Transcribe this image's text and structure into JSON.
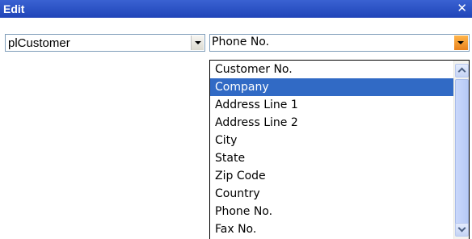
{
  "window": {
    "title": "Edit",
    "close_glyph": "✕"
  },
  "combo_left": {
    "value": "plCustomer"
  },
  "combo_right": {
    "value": "Phone No."
  },
  "dropdown": {
    "items": [
      {
        "label": "Customer No.",
        "selected": false
      },
      {
        "label": "Company",
        "selected": true
      },
      {
        "label": "Address Line 1",
        "selected": false
      },
      {
        "label": "Address Line 2",
        "selected": false
      },
      {
        "label": "City",
        "selected": false
      },
      {
        "label": "State",
        "selected": false
      },
      {
        "label": "Zip Code",
        "selected": false
      },
      {
        "label": "Country",
        "selected": false
      },
      {
        "label": "Phone No.",
        "selected": false
      },
      {
        "label": "Fax No.",
        "selected": false
      }
    ]
  },
  "colors": {
    "titlebar": "#2a53c8",
    "selection": "#316ac5",
    "dropdown_button": "#f29a35"
  }
}
